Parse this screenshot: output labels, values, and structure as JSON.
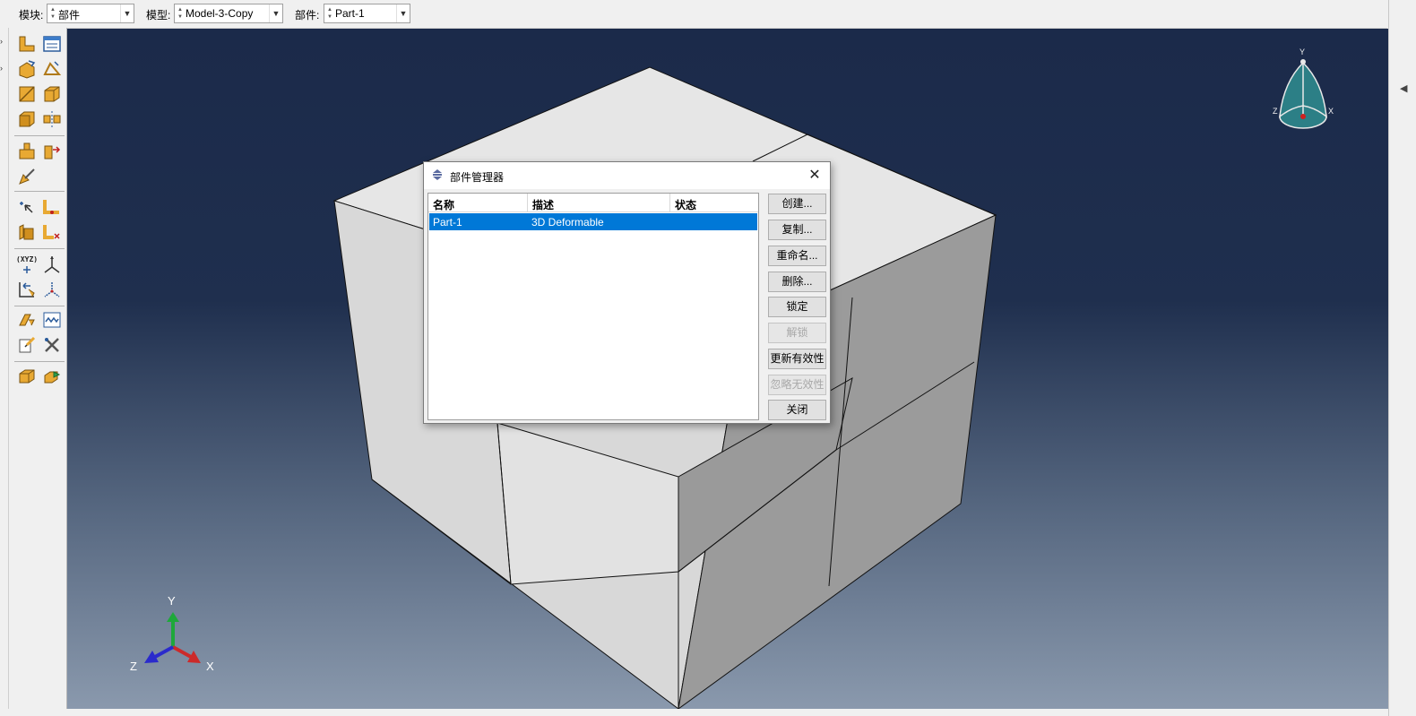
{
  "toolbar": {
    "module": {
      "label": "模块:",
      "value": "部件"
    },
    "model": {
      "label": "模型:",
      "value": "Model-3-Copy"
    },
    "part": {
      "label": "部件:",
      "value": "Part-1"
    }
  },
  "toolbox": {
    "xyz_label": "(XYZ)",
    "icons": [
      "create-part-icon",
      "part-manager-icon",
      "create-solid-icon",
      "create-shell-icon",
      "create-cut-icon",
      "create-extrude-icon",
      "create-round-icon",
      "mirror-icon",
      "partition-cell-icon",
      "partition-face-icon",
      "partition-edge-icon",
      "create-datum-icon",
      "virtual-topology-icon",
      "repair-icon",
      "remove-face-icon",
      "datum-point-icon",
      "datum-axis-icon",
      "datum-plane-icon",
      "datum-csys-icon",
      "stitch-icon",
      "wire-icon",
      "query-icon",
      "tools-icon",
      "assembly-icon",
      "set-icon"
    ]
  },
  "viewport": {
    "triad": {
      "x": "X",
      "y": "Y",
      "z": "Z"
    },
    "compass": {
      "x": "X",
      "y": "Y",
      "z": "Z"
    }
  },
  "dialog": {
    "title": "部件管理器",
    "columns": [
      "名称",
      "描述",
      "状态"
    ],
    "rows": [
      {
        "name": "Part-1",
        "description": "3D Deformable",
        "status": ""
      }
    ],
    "buttons": [
      {
        "label": "创建...",
        "enabled": true
      },
      {
        "label": "复制...",
        "enabled": true
      },
      {
        "label": "重命名...",
        "enabled": true
      },
      {
        "label": "删除...",
        "enabled": true
      },
      {
        "label": "锁定",
        "enabled": true
      },
      {
        "label": "解锁",
        "enabled": false
      },
      {
        "label": "更新有效性",
        "enabled": true
      },
      {
        "label": "忽略无效性",
        "enabled": false
      },
      {
        "label": "关闭",
        "enabled": true
      }
    ]
  },
  "colors": {
    "viewport_top": "#1b2a4a",
    "viewport_bottom": "#8a99ad",
    "selection": "#0078d7",
    "face_top": "#e6e6e6",
    "face_left": "#d6d6d6",
    "face_right": "#9c9c9c"
  }
}
